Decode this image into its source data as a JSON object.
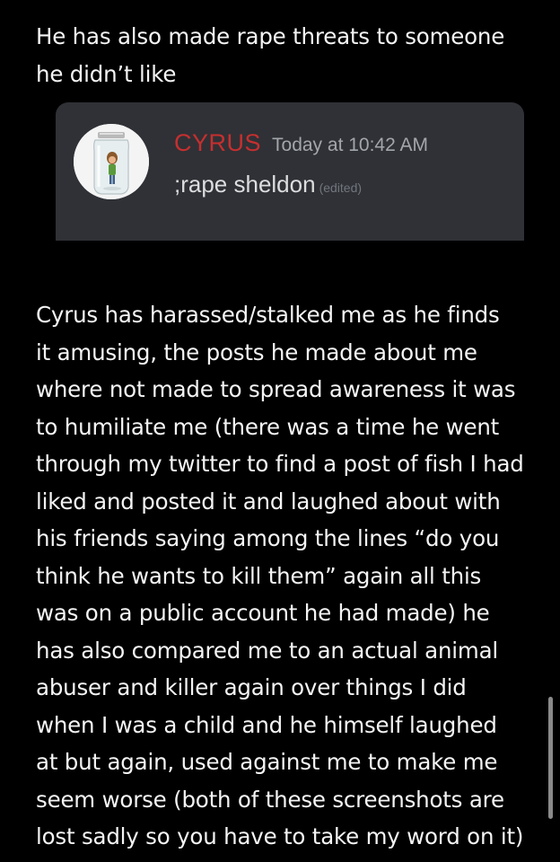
{
  "intro_text": "He has also made rape threats to someone\nhe didn’t like",
  "discord_message": {
    "username": "CYRUS",
    "timestamp": "Today at 10:42 AM",
    "message": ";rape sheldon",
    "edited_label": "(edited)",
    "avatar_icon": "jar-avatar-icon",
    "username_color": "#c62f2f"
  },
  "body_text": "Cyrus has harassed/stalked me as he finds\nit amusing, the posts he made about me\nwhere not made to spread awareness it was\nto humiliate me (there was a time he went\nthrough my twitter to find a post of fish I had\nliked and posted it and laughed about with\nhis friends saying among the lines “do you\nthink he wants to kill them” again all this\nwas on a public account he had made) he\nhas also compared me to an actual animal\nabuser and killer again over things I did\nwhen I was a child and he himself laughed\nat but again, used against me to make me\nseem worse (both of these screenshots are\nlost sadly so you have to take my word on it)"
}
